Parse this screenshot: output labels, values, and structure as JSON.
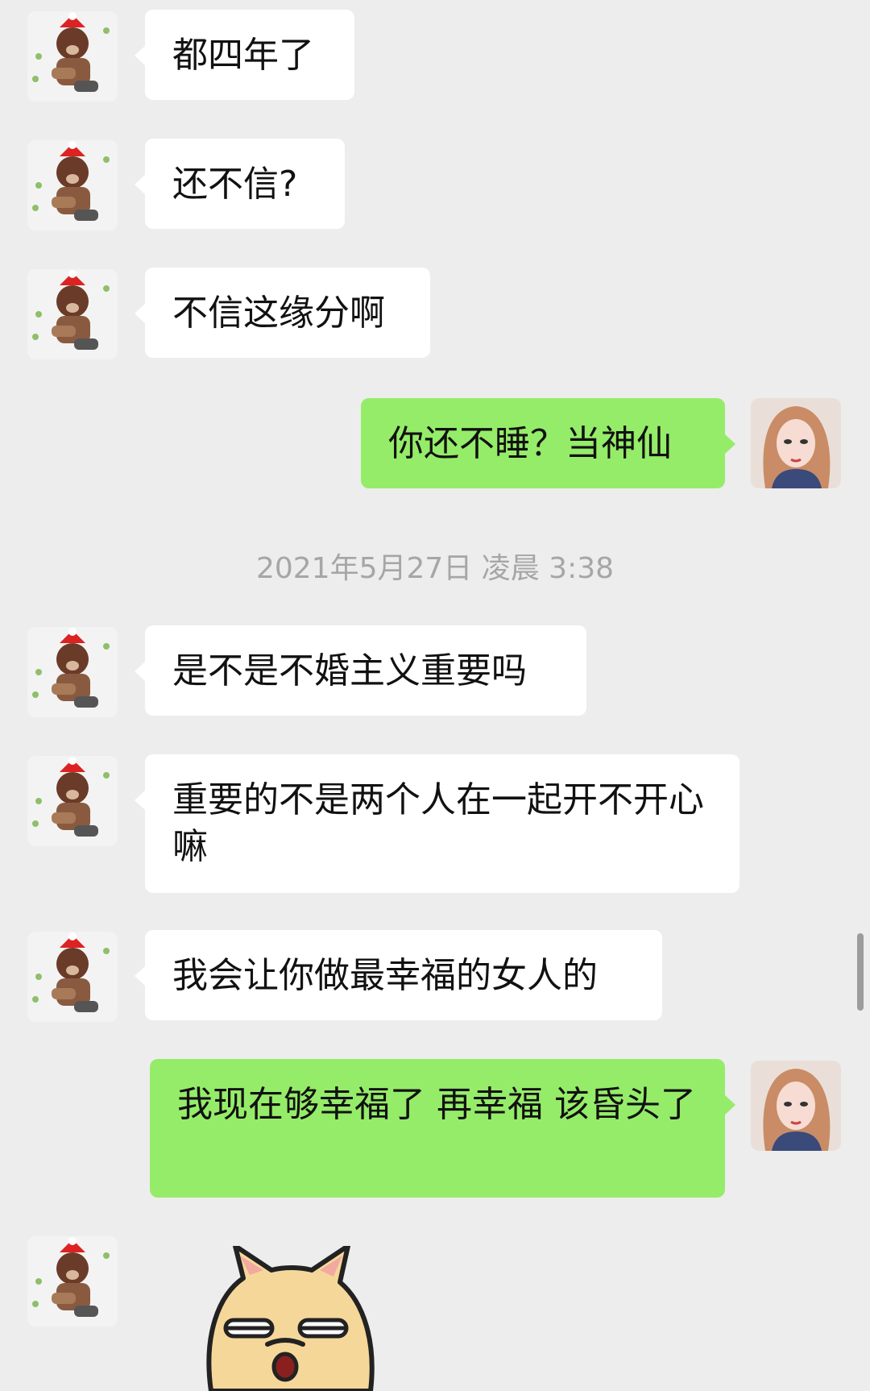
{
  "chat": {
    "messages": [
      {
        "side": "left",
        "text": "都四年了"
      },
      {
        "side": "left",
        "text": "还不信?"
      },
      {
        "side": "left",
        "text": "不信这缘分啊"
      },
      {
        "side": "right",
        "text": "你还不睡？当神仙"
      },
      {
        "side": "left",
        "text": "是不是不婚主义重要吗"
      },
      {
        "side": "left",
        "text": "重要的不是两个人在一起开不开心嘛"
      },
      {
        "side": "left",
        "text": "我会让你做最幸福的女人的"
      },
      {
        "side": "right",
        "text": "我现在够幸福了 再幸福 该昏头了"
      }
    ],
    "timestamp": "2021年5月27日 凌晨 3:38",
    "last_message": {
      "side": "left",
      "type": "sticker",
      "sticker": "shiba-dog-sticker"
    }
  },
  "colors": {
    "background": "#ededed",
    "incoming_bubble": "#ffffff",
    "outgoing_bubble": "#95ec69",
    "timestamp_text": "#a6a6a6"
  },
  "icons": {
    "contact_avatar": "bear-with-santa-hat-avatar",
    "self_avatar": "girl-portrait-avatar"
  }
}
